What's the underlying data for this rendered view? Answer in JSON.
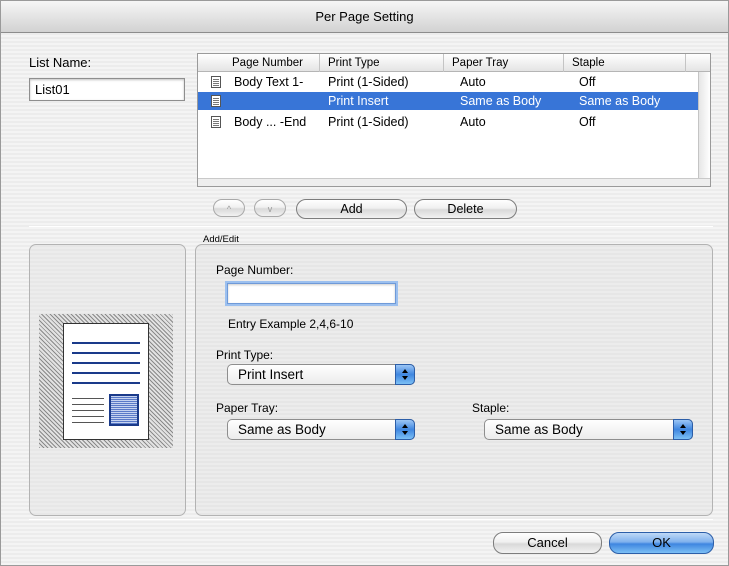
{
  "window": {
    "title": "Per Page Setting"
  },
  "list_name": {
    "label": "List Name:",
    "value": "List01"
  },
  "table": {
    "headers": [
      "Page Number",
      "Print Type",
      "Paper Tray",
      "Staple"
    ],
    "rows": [
      {
        "page_number": "Body Text 1-",
        "print_type": "Print (1-Sided)",
        "paper_tray": "Auto",
        "staple": "Off",
        "selected": false
      },
      {
        "page_number": "",
        "print_type": "Print Insert",
        "paper_tray": "Same as Body",
        "staple": "Same as Body",
        "selected": true
      },
      {
        "page_number": "Body ... -End",
        "print_type": "Print (1-Sided)",
        "paper_tray": "Auto",
        "staple": "Off",
        "selected": false
      }
    ]
  },
  "buttons": {
    "move_up": "^",
    "move_down": "v",
    "add": "Add",
    "delete": "Delete",
    "cancel": "Cancel",
    "ok": "OK"
  },
  "add_edit": {
    "group_label": "Add/Edit",
    "page_number_label": "Page Number:",
    "page_number_value": "",
    "entry_example": "Entry Example 2,4,6-10",
    "print_type_label": "Print Type:",
    "print_type_value": "Print Insert",
    "paper_tray_label": "Paper Tray:",
    "paper_tray_value": "Same as Body",
    "staple_label": "Staple:",
    "staple_value": "Same as Body"
  }
}
